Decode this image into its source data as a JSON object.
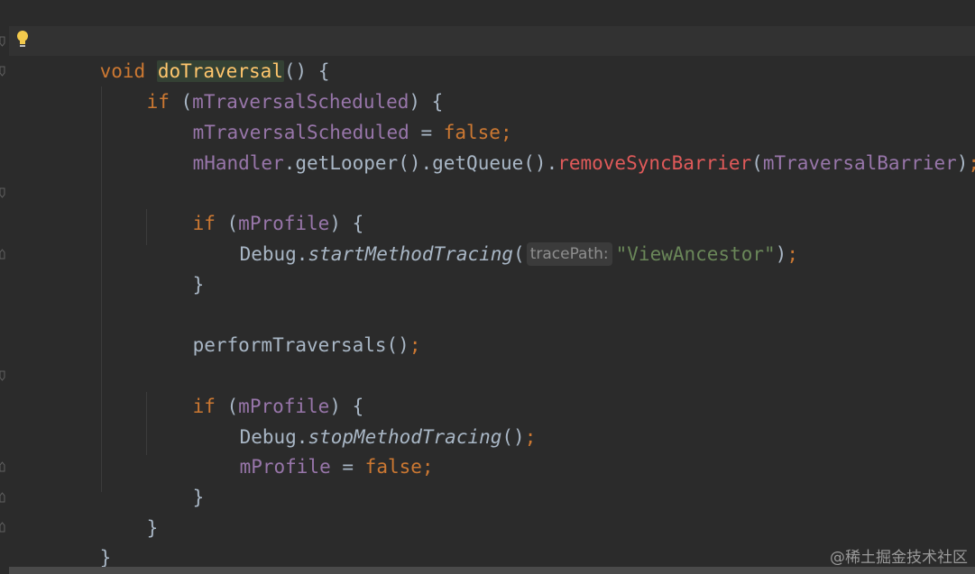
{
  "editor": {
    "colors": {
      "background": "#2b2b2b",
      "keyword": "#cc7832",
      "function_declaration": "#ffc66d",
      "field": "#9876aa",
      "identifier": "#a9b7c6",
      "method_call_highlight": "#e05a5a",
      "string": "#6a8759",
      "inlay_hint": "#8e8e8e"
    },
    "icons": {
      "gutter": "lightbulb-icon",
      "folds": "fold-marker-icon"
    },
    "code": {
      "l1": {
        "kw_void": "void",
        "fn_name": "doTraversal",
        "rest": "() {"
      },
      "l2": {
        "kw_if": "if",
        "p_open": " (",
        "field": "mTraversalScheduled",
        "p_close": ") {"
      },
      "l3": {
        "field": "mTraversalScheduled",
        "assign": " = ",
        "kw_false": "false",
        "semi": ";"
      },
      "l4": {
        "handler": "mHandler",
        "dot1": ".",
        "get_looper": "getLooper",
        "parens1": "().",
        "get_queue": "getQueue",
        "parens2": "().",
        "remove_barrier": "removeSyncBarrier",
        "p_open": "(",
        "arg": "mTraversalBarrier",
        "p_close": ")",
        "semi": ";"
      },
      "l6": {
        "kw_if": "if",
        "p_open": " (",
        "field": "mProfile",
        "p_close": ") {"
      },
      "l7": {
        "cls": "Debug",
        "dot": ".",
        "method": "startMethodTracing",
        "p_open": "(",
        "hint": "tracePath:",
        "str": "\"ViewAncestor\"",
        "p_close": ")",
        "semi": ";"
      },
      "l8": {
        "brace": "}"
      },
      "l10": {
        "call": "performTraversals",
        "parens": "()",
        "semi": ";"
      },
      "l12": {
        "kw_if": "if",
        "p_open": " (",
        "field": "mProfile",
        "p_close": ") {"
      },
      "l13": {
        "cls": "Debug",
        "dot": ".",
        "method": "stopMethodTracing",
        "parens": "()",
        "semi": ";"
      },
      "l14": {
        "field": "mProfile",
        "assign": " = ",
        "kw_false": "false",
        "semi": ";"
      },
      "l15": {
        "brace": "}"
      },
      "l16": {
        "brace": "}"
      },
      "l17": {
        "brace": "}"
      }
    },
    "watermark": "@稀土掘金技术社区"
  }
}
